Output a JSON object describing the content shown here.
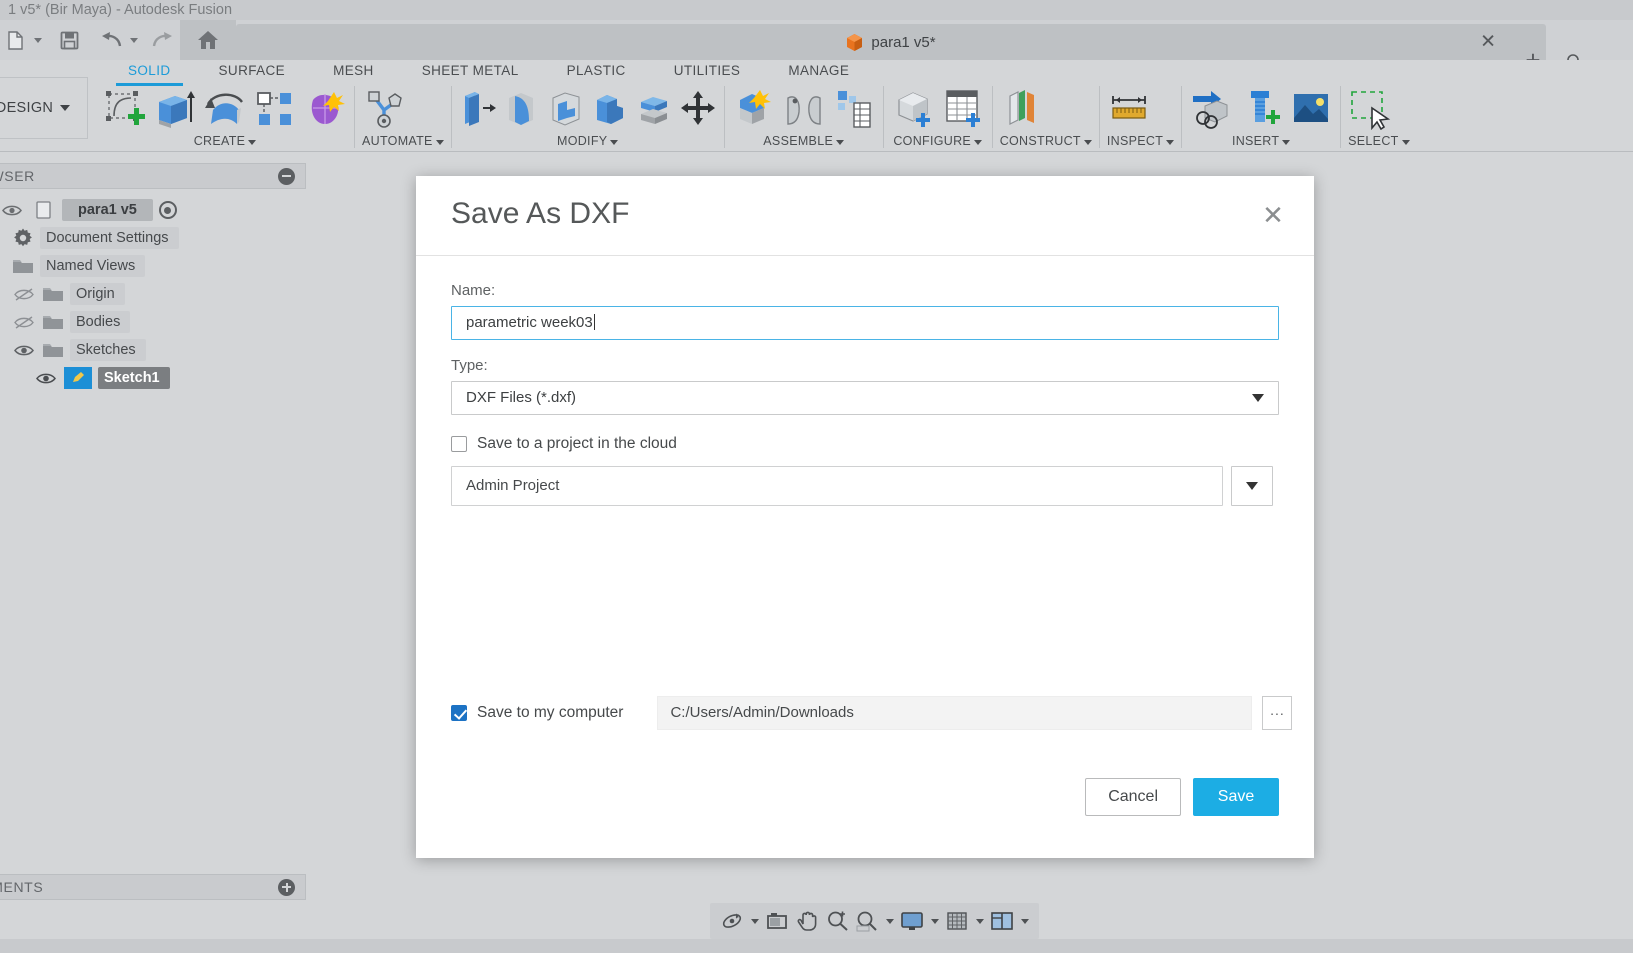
{
  "window": {
    "titlebar": "1 v5* (Bir Maya) - Autodesk Fusion"
  },
  "quick_access": {
    "new_icon": "new-document-icon",
    "save_icon": "save-icon",
    "undo_icon": "undo-icon",
    "redo_icon": "redo-icon",
    "home_icon": "home-icon"
  },
  "document_tab": {
    "label": "para1 v5*",
    "icon": "orange-cube-icon",
    "close_icon": "close-icon",
    "new_tab_icon": "plus-icon",
    "overflow_icon": "chevron-icon"
  },
  "ribbon": {
    "workspace": "DESIGN",
    "tabs": [
      {
        "label": "SOLID",
        "active": true
      },
      {
        "label": "SURFACE",
        "active": false
      },
      {
        "label": "MESH",
        "active": false
      },
      {
        "label": "SHEET METAL",
        "active": false
      },
      {
        "label": "PLASTIC",
        "active": false
      },
      {
        "label": "UTILITIES",
        "active": false
      },
      {
        "label": "MANAGE",
        "active": false
      }
    ],
    "panels": [
      {
        "title": "CREATE",
        "dropdown": true
      },
      {
        "title": "AUTOMATE",
        "dropdown": true
      },
      {
        "title": "MODIFY",
        "dropdown": true
      },
      {
        "title": "ASSEMBLE",
        "dropdown": true
      },
      {
        "title": "CONFIGURE",
        "dropdown": true
      },
      {
        "title": "CONSTRUCT",
        "dropdown": true
      },
      {
        "title": "INSPECT",
        "dropdown": true
      },
      {
        "title": "INSERT",
        "dropdown": true
      },
      {
        "title": "SELECT",
        "dropdown": true
      }
    ]
  },
  "browser": {
    "header": "OWSER",
    "collapse_icon": "minus-icon",
    "items": [
      {
        "label": "para1 v5",
        "kind": "root",
        "visible": true
      },
      {
        "label": "Document Settings",
        "kind": "settings"
      },
      {
        "label": "Named Views",
        "kind": "folder"
      },
      {
        "label": "Origin",
        "kind": "folder",
        "hidden": true
      },
      {
        "label": "Bodies",
        "kind": "folder",
        "hidden": true
      },
      {
        "label": "Sketches",
        "kind": "folder",
        "visible": true
      },
      {
        "label": "Sketch1",
        "kind": "sketch",
        "selected": true,
        "visible": true
      }
    ]
  },
  "comments": {
    "header": "MMENTS",
    "add_icon": "plus-icon"
  },
  "navbar": {
    "buttons": [
      "orbit-icon",
      "look-at-icon",
      "pan-icon",
      "zoom-icon",
      "zoom-fit-icon",
      "display-settings-icon",
      "grid-snaps-icon",
      "viewports-icon"
    ]
  },
  "dialog": {
    "title": "Save As DXF",
    "close_icon": "close-icon",
    "name_label": "Name:",
    "name_value": "parametric week03",
    "type_label": "Type:",
    "type_value": "DXF Files (*.dxf)",
    "type_caret_icon": "chevron-down-icon",
    "cloud_checkbox_label": "Save to a project in the cloud",
    "cloud_checkbox_checked": false,
    "project_value": "Admin Project",
    "project_caret_icon": "chevron-down-icon",
    "local_checkbox_label": "Save to my computer",
    "local_checkbox_checked": true,
    "path_value": "C:/Users/Admin/Downloads",
    "browse_label": "...",
    "cancel_label": "Cancel",
    "save_label": "Save"
  },
  "colors": {
    "accent_blue": "#1cade4",
    "tab_active": "#1c9bd8",
    "checkbox_checked": "#1c72c4",
    "model_fill": "#6f9fdb",
    "window_chrome": "#d4d6d8"
  }
}
